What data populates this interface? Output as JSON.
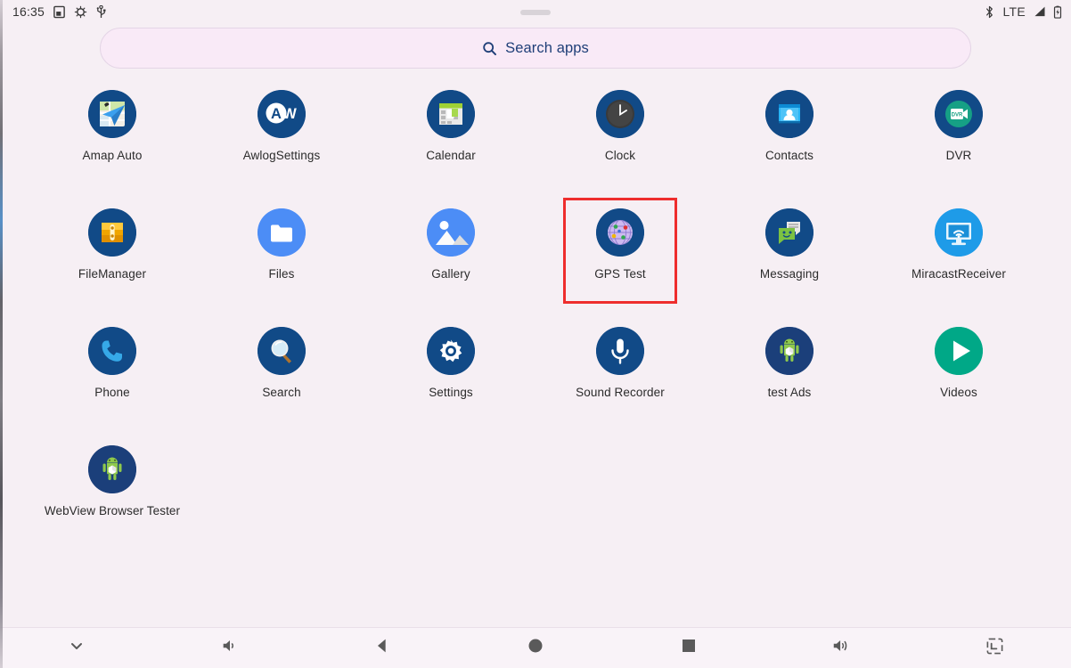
{
  "status_bar": {
    "clock": "16:35",
    "left_icons": [
      {
        "name": "screenshot-icon"
      },
      {
        "name": "bug-report-icon"
      },
      {
        "name": "usb-icon"
      }
    ],
    "right_icons": [
      {
        "name": "bluetooth-icon"
      },
      {
        "name": "lte-label",
        "label": "LTE"
      },
      {
        "name": "signal-icon"
      },
      {
        "name": "battery-icon"
      }
    ]
  },
  "search": {
    "placeholder": "Search apps",
    "icon": "search-icon"
  },
  "apps": [
    {
      "label": "Amap Auto",
      "icon": "amap-auto-icon",
      "selected": false
    },
    {
      "label": "AwlogSettings",
      "icon": "awlog-settings-icon",
      "selected": false
    },
    {
      "label": "Calendar",
      "icon": "calendar-icon",
      "selected": false
    },
    {
      "label": "Clock",
      "icon": "clock-icon",
      "selected": false
    },
    {
      "label": "Contacts",
      "icon": "contacts-icon",
      "selected": false
    },
    {
      "label": "DVR",
      "icon": "dvr-icon",
      "selected": false
    },
    {
      "label": "FileManager",
      "icon": "file-manager-icon",
      "selected": false
    },
    {
      "label": "Files",
      "icon": "files-icon",
      "selected": false
    },
    {
      "label": "Gallery",
      "icon": "gallery-icon",
      "selected": false
    },
    {
      "label": "GPS Test",
      "icon": "gps-test-icon",
      "selected": true
    },
    {
      "label": "Messaging",
      "icon": "messaging-icon",
      "selected": false
    },
    {
      "label": "MiracastReceiver",
      "icon": "miracast-receiver-icon",
      "selected": false
    },
    {
      "label": "Phone",
      "icon": "phone-icon",
      "selected": false
    },
    {
      "label": "Search",
      "icon": "search-app-icon",
      "selected": false
    },
    {
      "label": "Settings",
      "icon": "settings-icon",
      "selected": false
    },
    {
      "label": "Sound Recorder",
      "icon": "sound-recorder-icon",
      "selected": false
    },
    {
      "label": "test Ads",
      "icon": "test-ads-icon",
      "selected": false
    },
    {
      "label": "Videos",
      "icon": "videos-icon",
      "selected": false
    },
    {
      "label": "WebView Browser Tester",
      "icon": "webview-browser-tester-icon",
      "selected": false
    }
  ],
  "nav_bar": {
    "buttons": [
      {
        "name": "collapse-button",
        "icon": "chevron-down-icon"
      },
      {
        "name": "volume-down-button",
        "icon": "volume-down-icon"
      },
      {
        "name": "back-button",
        "icon": "back-triangle-icon"
      },
      {
        "name": "home-button",
        "icon": "home-circle-icon"
      },
      {
        "name": "recents-button",
        "icon": "square-icon"
      },
      {
        "name": "volume-up-button",
        "icon": "volume-up-icon"
      },
      {
        "name": "screenshot-button",
        "icon": "screenshot-frame-icon"
      }
    ]
  },
  "colors": {
    "background": "#f6eff4",
    "search_fill": "#f9eaf7",
    "accent_blue": "#114a87",
    "selection_red": "#ee2d2d",
    "label_text": "#2b2b2b"
  }
}
